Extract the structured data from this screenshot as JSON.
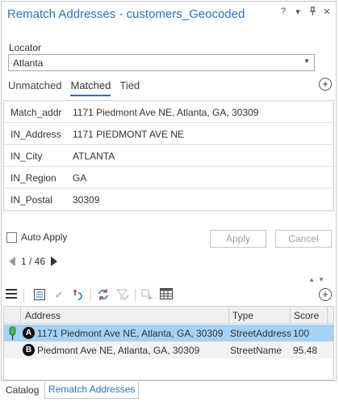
{
  "title": "Rematch Addresses - customers_Geocoded",
  "title_tools": [
    "?",
    "▾",
    "⊓",
    "✕"
  ],
  "locator": {
    "label": "Locator",
    "value": "Atlanta"
  },
  "tabs": [
    {
      "label": "Unmatched",
      "active": false
    },
    {
      "label": "Matched",
      "active": true
    },
    {
      "label": "Tied",
      "active": false
    }
  ],
  "fields": [
    {
      "name": "Match_addr",
      "value": "1171 Piedmont Ave NE, Atlanta, GA, 30309"
    },
    {
      "name": "IN_Address",
      "value": "1171 PIEDMONT AVE NE"
    },
    {
      "name": "IN_City",
      "value": "ATLANTA"
    },
    {
      "name": "IN_Region",
      "value": "GA"
    },
    {
      "name": "IN_Postal",
      "value": "30309"
    }
  ],
  "auto_apply": {
    "label": "Auto Apply",
    "checked": false
  },
  "buttons": {
    "apply": "Apply",
    "cancel": "Cancel"
  },
  "pager": {
    "text": "1 / 46"
  },
  "candidates": {
    "columns": [
      "Address",
      "Type",
      "Score"
    ],
    "rows": [
      {
        "badge": "A",
        "address": "1171 Piedmont Ave NE, Atlanta, GA, 30309",
        "type": "StreetAddress",
        "score": "100",
        "selected": true
      },
      {
        "badge": "B",
        "address": "Piedmont Ave NE, Atlanta, GA, 30309",
        "type": "StreetName",
        "score": "95.48",
        "selected": false
      }
    ]
  },
  "bottom_tabs": [
    {
      "label": "Catalog",
      "active": false
    },
    {
      "label": "Rematch Addresses",
      "active": true
    }
  ],
  "colors": {
    "accent": "#2a74b8",
    "selection": "#a6d2f5",
    "pin": "#4caf50"
  }
}
